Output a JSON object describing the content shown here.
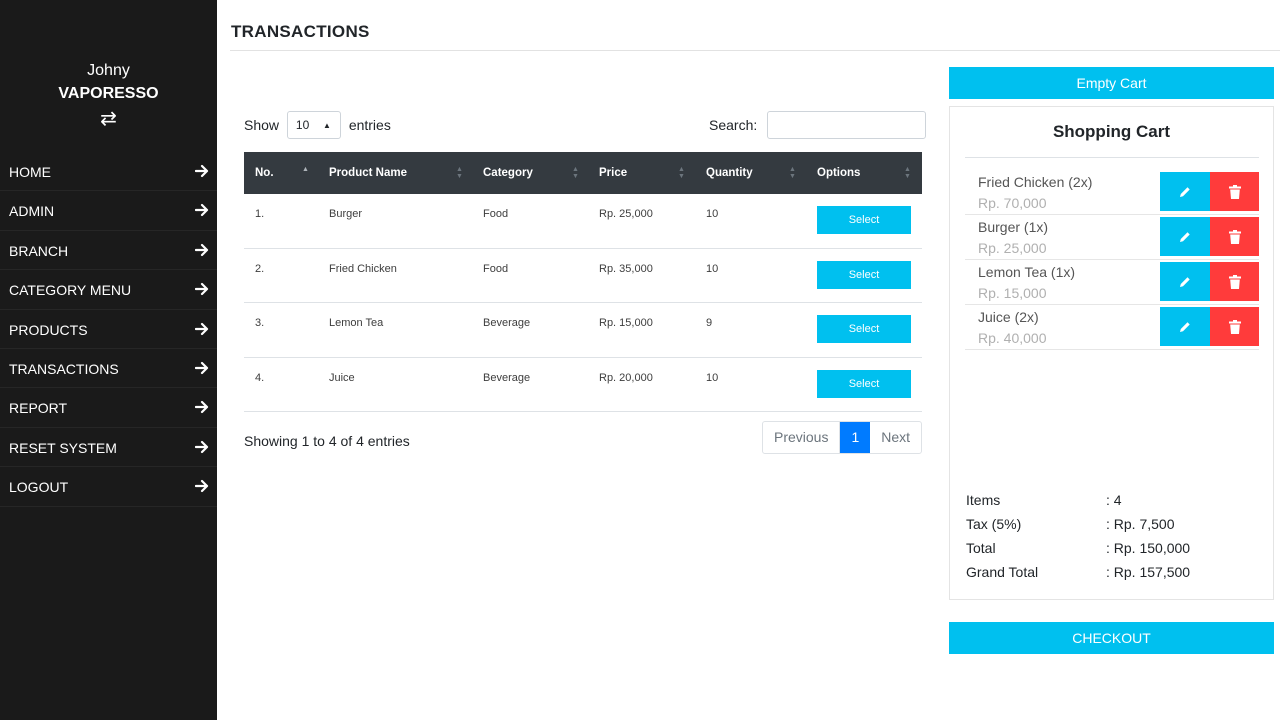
{
  "user": {
    "first_name": "Johny",
    "last_name": "VAPORESSO"
  },
  "sidebar": {
    "items": [
      {
        "label": "HOME"
      },
      {
        "label": "ADMIN"
      },
      {
        "label": "BRANCH"
      },
      {
        "label": "CATEGORY MENU"
      },
      {
        "label": "PRODUCTS"
      },
      {
        "label": "TRANSACTIONS"
      },
      {
        "label": "REPORT"
      },
      {
        "label": "RESET SYSTEM"
      },
      {
        "label": "LOGOUT"
      }
    ]
  },
  "page": {
    "title": "TRANSACTIONS"
  },
  "table_controls": {
    "show_label": "Show",
    "entries_value": "10",
    "entries_label": "entries",
    "search_label": "Search:",
    "search_value": ""
  },
  "table": {
    "columns": [
      "No.",
      "Product Name",
      "Category",
      "Price",
      "Quantity",
      "Options"
    ],
    "rows": [
      {
        "no": "1.",
        "name": "Burger",
        "category": "Food",
        "price": "Rp. 25,000",
        "quantity": "10",
        "option": "Select"
      },
      {
        "no": "2.",
        "name": "Fried Chicken",
        "category": "Food",
        "price": "Rp. 35,000",
        "quantity": "10",
        "option": "Select"
      },
      {
        "no": "3.",
        "name": "Lemon Tea",
        "category": "Beverage",
        "price": "Rp. 15,000",
        "quantity": "9",
        "option": "Select"
      },
      {
        "no": "4.",
        "name": "Juice",
        "category": "Beverage",
        "price": "Rp. 20,000",
        "quantity": "10",
        "option": "Select"
      }
    ],
    "info": "Showing 1 to 4 of 4 entries"
  },
  "pagination": {
    "previous": "Previous",
    "current": "1",
    "next": "Next"
  },
  "cart": {
    "empty_label": "Empty Cart",
    "title": "Shopping Cart",
    "items": [
      {
        "name": "Fried Chicken (2x)",
        "price": "Rp. 70,000"
      },
      {
        "name": "Burger (1x)",
        "price": "Rp. 25,000"
      },
      {
        "name": "Lemon Tea (1x)",
        "price": "Rp. 15,000"
      },
      {
        "name": "Juice (2x)",
        "price": "Rp. 40,000"
      }
    ],
    "summary": [
      {
        "label": "Items",
        "value": ": 4"
      },
      {
        "label": "Tax (5%)",
        "value": ": Rp. 7,500"
      },
      {
        "label": "Total",
        "value": ": Rp. 150,000"
      },
      {
        "label": "Grand Total",
        "value": ": Rp. 157,500"
      }
    ],
    "checkout_label": "CHECKOUT"
  },
  "colors": {
    "sidebar_bg": "#1a1a1a",
    "accent": "#00c0ef",
    "danger": "#ff3b3b",
    "table_header": "#343a40",
    "pagination_active": "#007bff"
  },
  "icons": {
    "user_switch": "swap-arrows-icon",
    "nav_arrow": "arrow-right-icon",
    "edit": "pencil-icon",
    "delete": "trash-icon"
  }
}
